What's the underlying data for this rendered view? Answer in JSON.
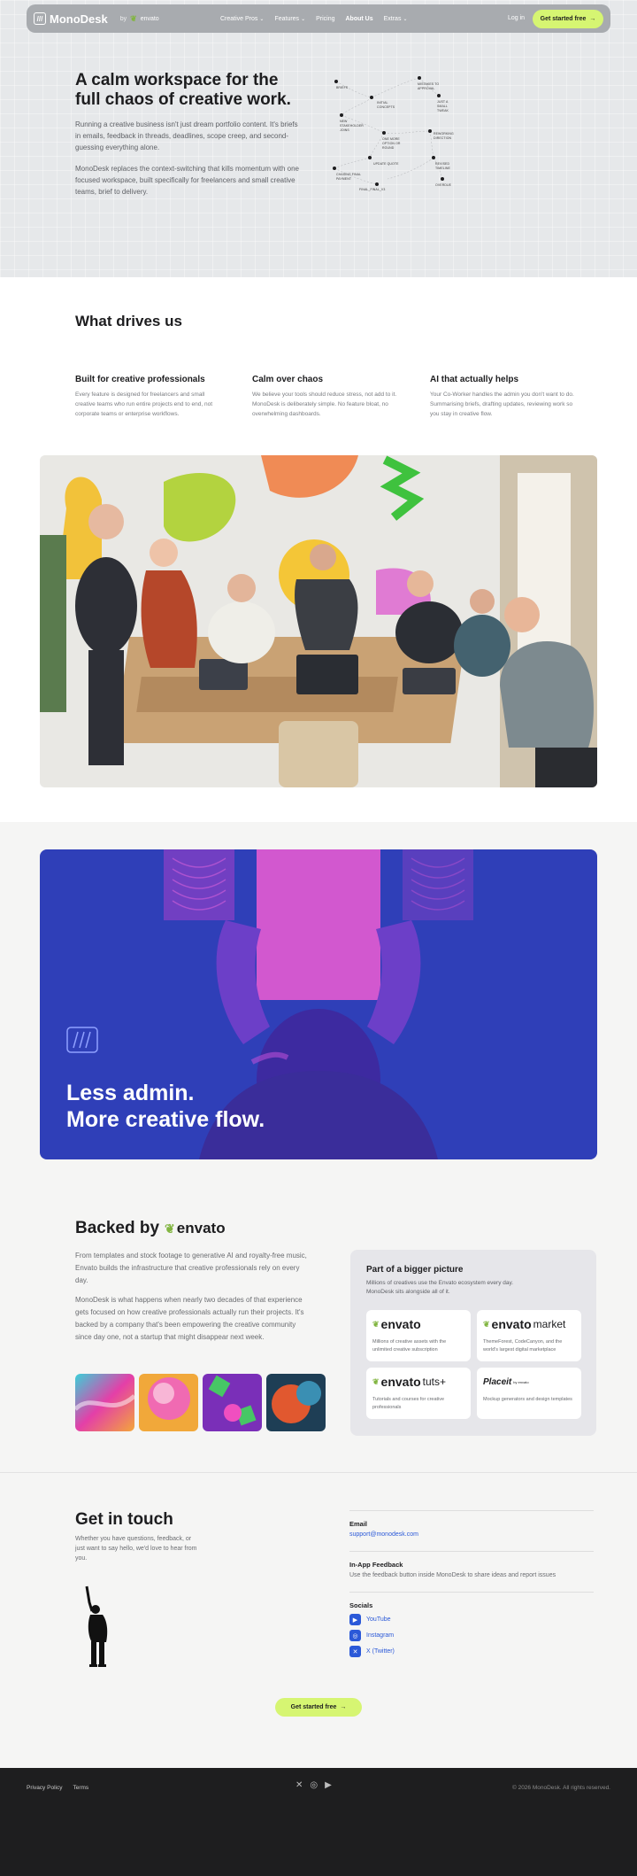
{
  "nav": {
    "logo": "MonoDesk",
    "by_label": "by",
    "by_brand": "envato",
    "links": [
      "Creative Pros",
      "Features",
      "Pricing",
      "About Us",
      "Extras"
    ],
    "login": "Log in",
    "cta": "Get started free"
  },
  "hero": {
    "title": "A calm workspace for the full chaos of creative work.",
    "p1": "Running a creative business isn't just dream portfolio content. It's briefs in emails, feedback in threads, deadlines, scope creep, and second-guessing everything alone.",
    "p2": "MonoDesk replaces the context-switching that kills momentum with one focused workspace, built specifically for freelancers and small creative teams, brief to delivery.",
    "flow_nodes": [
      "Briefs",
      "Initial concepts",
      "Mistakes to approval",
      "Just a small tweak",
      "New stakeholder joins",
      "One more option or round",
      "Reworking direction",
      "Update quote",
      "Revised timeline",
      "Chasing final payment",
      "Final_final_v3",
      "Overdue"
    ]
  },
  "drives": {
    "title": "What drives us",
    "cols": [
      {
        "title": "Built for creative professionals",
        "text": "Every feature is designed for freelancers and small creative teams who run entire projects end to end, not corporate teams or enterprise workflows."
      },
      {
        "title": "Calm over chaos",
        "text": "We believe your tools should reduce stress, not add to it. MonoDesk is deliberately simple. No feature bloat, no overwhelming dashboards."
      },
      {
        "title": "AI that actually helps",
        "text": "Your Co-Worker handles the admin you don't want to do. Summarising briefs, drafting updates, reviewing work so you stay in creative flow."
      }
    ]
  },
  "banner": {
    "line1": "Less admin.",
    "line2": "More creative flow."
  },
  "backed": {
    "title": "Backed by",
    "brand": "envato",
    "p1": "From templates and stock footage to generative AI and royalty-free music, Envato builds the infrastructure that creative professionals rely on every day.",
    "p2": "MonoDesk is what happens when nearly two decades of that experience gets focused on how creative professionals actually run their projects. It's backed by a company that's been empowering the creative community since day one, not a startup that might disappear next week.",
    "panel_title": "Part of a bigger picture",
    "panel_sub": "Millions of creatives use the Envato ecosystem every day. MonoDesk sits alongside all of it.",
    "cards": [
      {
        "brand": "envato",
        "suffix": "",
        "desc": "Millions of creative assets with the unlimited creative subscription"
      },
      {
        "brand": "envato",
        "suffix": "market",
        "desc": "ThemeForest, CodeCanyon, and the world's largest digital marketplace"
      },
      {
        "brand": "envato",
        "suffix": "tuts+",
        "desc": "Tutorials and courses for creative professionals"
      },
      {
        "brand": "Placeit",
        "suffix": "by envato",
        "desc": "Mockup generators and design templates"
      }
    ]
  },
  "contact": {
    "title": "Get in touch",
    "intro": "Whether you have questions, feedback, or just want to say hello, we'd love to hear from you.",
    "email_label": "Email",
    "email": "support@monodesk.com",
    "feedback_label": "In-App Feedback",
    "feedback_text": "Use the feedback button inside MonoDesk to share ideas and report issues",
    "socials_label": "Socials",
    "socials": [
      "YouTube",
      "Instagram",
      "X (Twitter)"
    ],
    "cta": "Get started free"
  },
  "footer": {
    "links": [
      "Privacy Policy",
      "Terms"
    ],
    "copyright": "© 2026 MonoDesk. All rights reserved."
  }
}
